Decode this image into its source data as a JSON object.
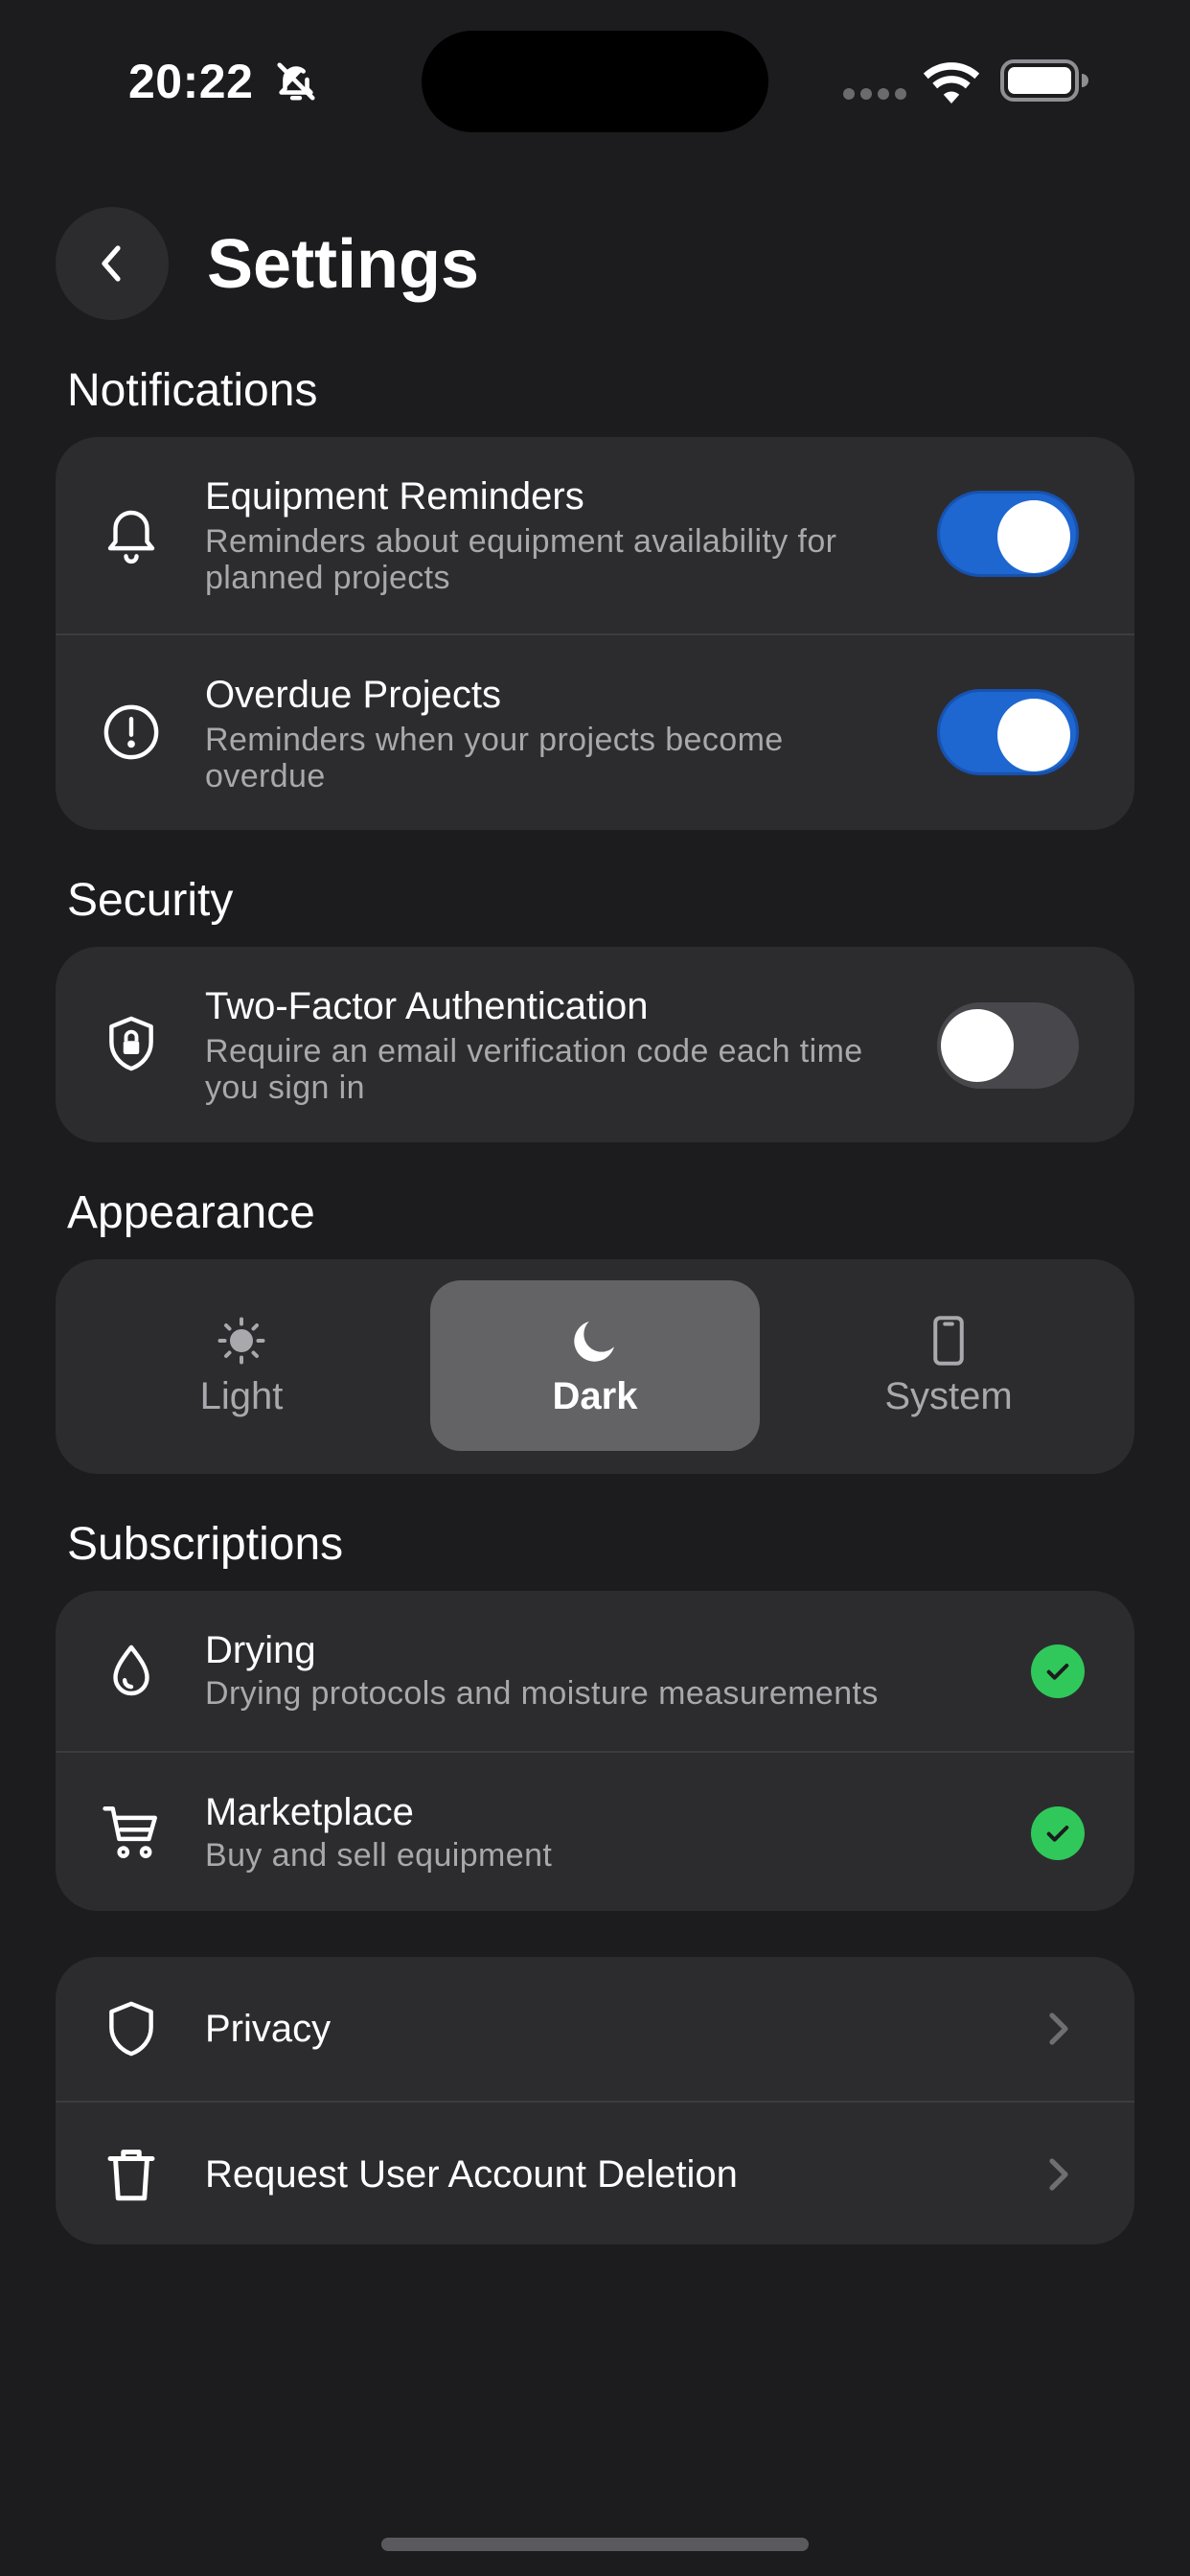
{
  "status": {
    "time": "20:22"
  },
  "header": {
    "title": "Settings"
  },
  "notifications": {
    "title": "Notifications",
    "items": [
      {
        "title": "Equipment Reminders",
        "subtitle": "Reminders about equipment availability for planned projects",
        "enabled": true,
        "icon": "bell-icon"
      },
      {
        "title": "Overdue Projects",
        "subtitle": "Reminders when your projects become overdue",
        "enabled": true,
        "icon": "alert-circle-icon"
      }
    ]
  },
  "security": {
    "title": "Security",
    "items": [
      {
        "title": "Two-Factor Authentication",
        "subtitle": "Require an email verification code each time you sign in",
        "enabled": false,
        "icon": "shield-lock-icon"
      }
    ]
  },
  "appearance": {
    "title": "Appearance",
    "options": [
      {
        "label": "Light",
        "icon": "sun-icon"
      },
      {
        "label": "Dark",
        "icon": "moon-icon"
      },
      {
        "label": "System",
        "icon": "phone-icon"
      }
    ],
    "selected": "Dark"
  },
  "subscriptions": {
    "title": "Subscriptions",
    "items": [
      {
        "title": "Drying",
        "subtitle": "Drying protocols and moisture measurements",
        "icon": "droplet-icon",
        "active": true
      },
      {
        "title": "Marketplace",
        "subtitle": "Buy and sell equipment",
        "icon": "cart-icon",
        "active": true
      }
    ]
  },
  "links": {
    "items": [
      {
        "label": "Privacy",
        "icon": "shield-icon"
      },
      {
        "label": "Request User Account Deletion",
        "icon": "trash-icon"
      }
    ]
  },
  "colors": {
    "background": "#1c1c1e",
    "card": "#2c2c2e",
    "accent": "#1e66d0",
    "success": "#30c85a"
  }
}
